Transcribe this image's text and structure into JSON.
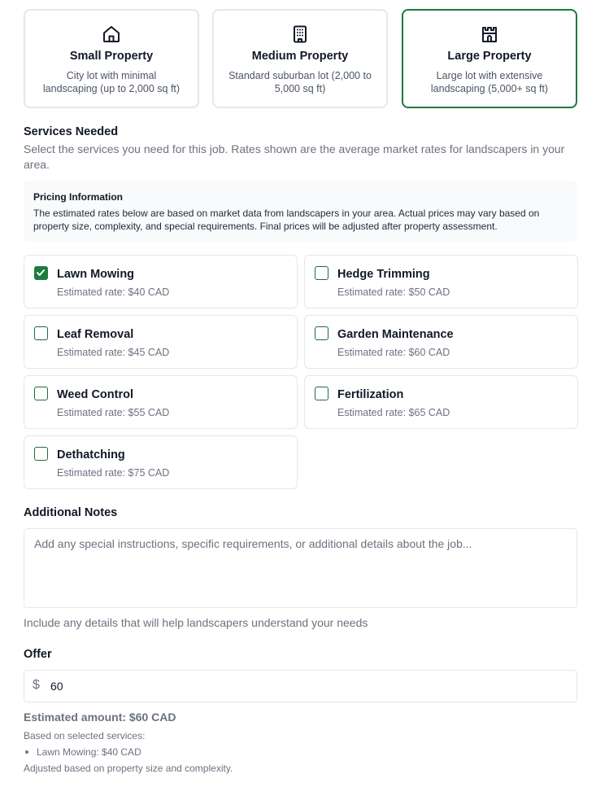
{
  "property_sizes": [
    {
      "icon": "house-icon",
      "title": "Small Property",
      "desc": "City lot with minimal landscaping (up to 2,000 sq ft)",
      "selected": false
    },
    {
      "icon": "building-icon",
      "title": "Medium Property",
      "desc": "Standard suburban lot (2,000 to 5,000 sq ft)",
      "selected": false
    },
    {
      "icon": "castle-icon",
      "title": "Large Property",
      "desc": "Large lot with extensive landscaping (5,000+ sq ft)",
      "selected": true
    }
  ],
  "services": {
    "title": "Services Needed",
    "desc": "Select the services you need for this job. Rates shown are the average market rates for landscapers in your area.",
    "pricing_info": {
      "title": "Pricing Information",
      "text": "The estimated rates below are based on market data from landscapers in your area. Actual prices may vary based on property size, complexity, and special requirements. Final prices will be adjusted after property assessment."
    },
    "items": [
      {
        "name": "Lawn Mowing",
        "rate": "Estimated rate: $40 CAD",
        "checked": true
      },
      {
        "name": "Hedge Trimming",
        "rate": "Estimated rate: $50 CAD",
        "checked": false
      },
      {
        "name": "Leaf Removal",
        "rate": "Estimated rate: $45 CAD",
        "checked": false
      },
      {
        "name": "Garden Maintenance",
        "rate": "Estimated rate: $60 CAD",
        "checked": false
      },
      {
        "name": "Weed Control",
        "rate": "Estimated rate: $55 CAD",
        "checked": false
      },
      {
        "name": "Fertilization",
        "rate": "Estimated rate: $65 CAD",
        "checked": false
      },
      {
        "name": "Dethatching",
        "rate": "Estimated rate: $75 CAD",
        "checked": false
      }
    ]
  },
  "notes": {
    "title": "Additional Notes",
    "placeholder": "Add any special instructions, specific requirements, or additional details about the job...",
    "value": "",
    "help": "Include any details that will help landscapers understand your needs"
  },
  "offer": {
    "title": "Offer",
    "currency_symbol": "$",
    "value": "60",
    "estimated_amount": "Estimated amount: $60 CAD",
    "based_on": "Based on selected services:",
    "breakdown": [
      "Lawn Mowing: $40 CAD"
    ],
    "adjusted_note": "Adjusted based on property size and complexity."
  },
  "colors": {
    "accent": "#1f7a3f",
    "border": "#e5e7eb",
    "muted_text": "#6b7280"
  }
}
